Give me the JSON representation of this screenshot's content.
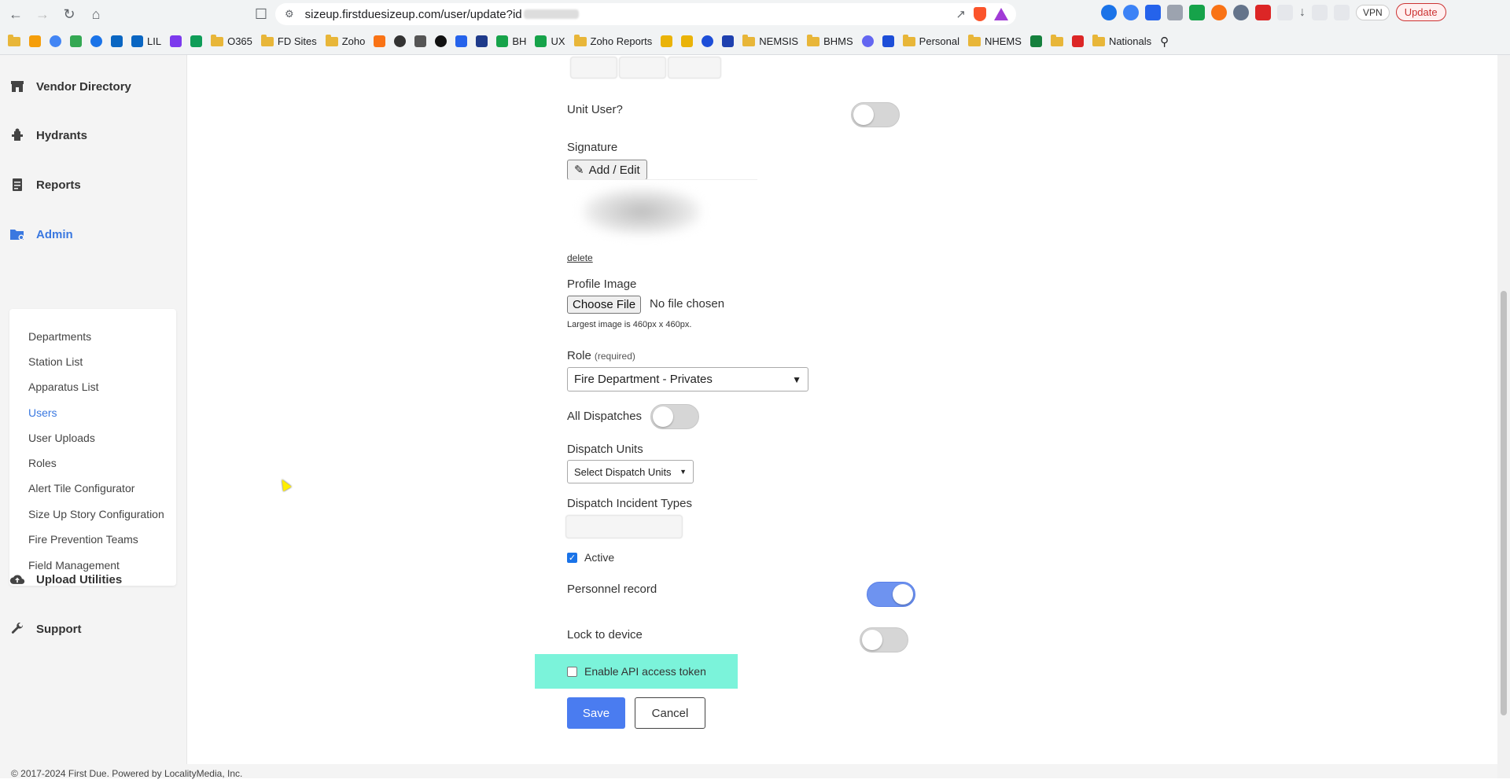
{
  "browser": {
    "url_text": "sizeup.firstduesizeup.com/user/update?id",
    "vpn_label": "VPN",
    "update_label": "Update"
  },
  "bookmarks": [
    "LIL",
    "O365",
    "FD Sites",
    "Zoho",
    "BH",
    "UX",
    "Zoho Reports",
    "NEMSIS",
    "BHMS",
    "Personal",
    "NHEMS",
    "Nationals"
  ],
  "sidebar": {
    "items": [
      {
        "label": "Vendor Directory",
        "icon": "store-icon"
      },
      {
        "label": "Hydrants",
        "icon": "hydrant-icon"
      },
      {
        "label": "Reports",
        "icon": "reports-icon"
      },
      {
        "label": "Admin",
        "icon": "admin-folder-icon"
      },
      {
        "label": "Upload Utilities",
        "icon": "cloud-upload-icon"
      },
      {
        "label": "Support",
        "icon": "wrench-icon"
      }
    ],
    "admin_sub": [
      "Departments",
      "Station List",
      "Apparatus List",
      "Users",
      "User Uploads",
      "Roles",
      "Alert Tile Configurator",
      "Size Up Story Configuration",
      "Fire Prevention Teams",
      "Field Management"
    ],
    "active_sub": "Users"
  },
  "form": {
    "unit_user_label": "Unit User?",
    "unit_user_on": false,
    "signature_label": "Signature",
    "add_edit_label": "Add / Edit",
    "delete_label": "delete",
    "profile_image_label": "Profile Image",
    "choose_file_label": "Choose File",
    "no_file_text": "No file chosen",
    "image_help": "Largest image is 460px x 460px.",
    "role_label": "Role",
    "role_required": "(required)",
    "role_value": "Fire Department - Privates",
    "all_dispatches_label": "All Dispatches",
    "all_dispatches_on": false,
    "dispatch_units_label": "Dispatch Units",
    "dispatch_units_button": "Select Dispatch Units",
    "dispatch_incident_types_label": "Dispatch Incident Types",
    "active_label": "Active",
    "active_checked": true,
    "personnel_record_label": "Personnel record",
    "personnel_record_on": true,
    "lock_to_device_label": "Lock to device",
    "lock_to_device_on": false,
    "api_token_label": "Enable API access token",
    "api_token_checked": false,
    "save_label": "Save",
    "cancel_label": "Cancel"
  },
  "footer": {
    "text": "© 2017-2024 First Due. Powered by LocalityMedia, Inc."
  },
  "colors": {
    "accent": "#3a78e0",
    "highlight": "#7bf3da",
    "primary_button": "#4a7cf0"
  }
}
